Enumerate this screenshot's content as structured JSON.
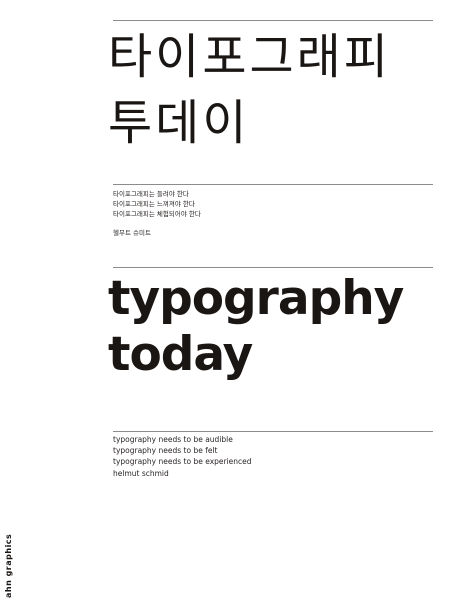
{
  "cover": {
    "title_ko_line1": "타이포그래피",
    "title_ko_line2": "투데이",
    "subtitle_ko": [
      "타이포그래피는 들려야 한다",
      "타이포그래피는 느껴져야 한다",
      "타이포그래피는 체험되어야 한다"
    ],
    "author_ko": "헬무트 슈미트",
    "title_en_line1": "typography",
    "title_en_line2": "today",
    "subtitle_en": [
      "typography needs to be audible",
      "typography needs to be felt",
      "typography needs to be experienced"
    ],
    "author_en": "helmut schmid",
    "publisher": "ahn graphics"
  },
  "colors": {
    "background": "#ffffff",
    "text": "#1a1614",
    "rule": "#8c8c8c"
  }
}
